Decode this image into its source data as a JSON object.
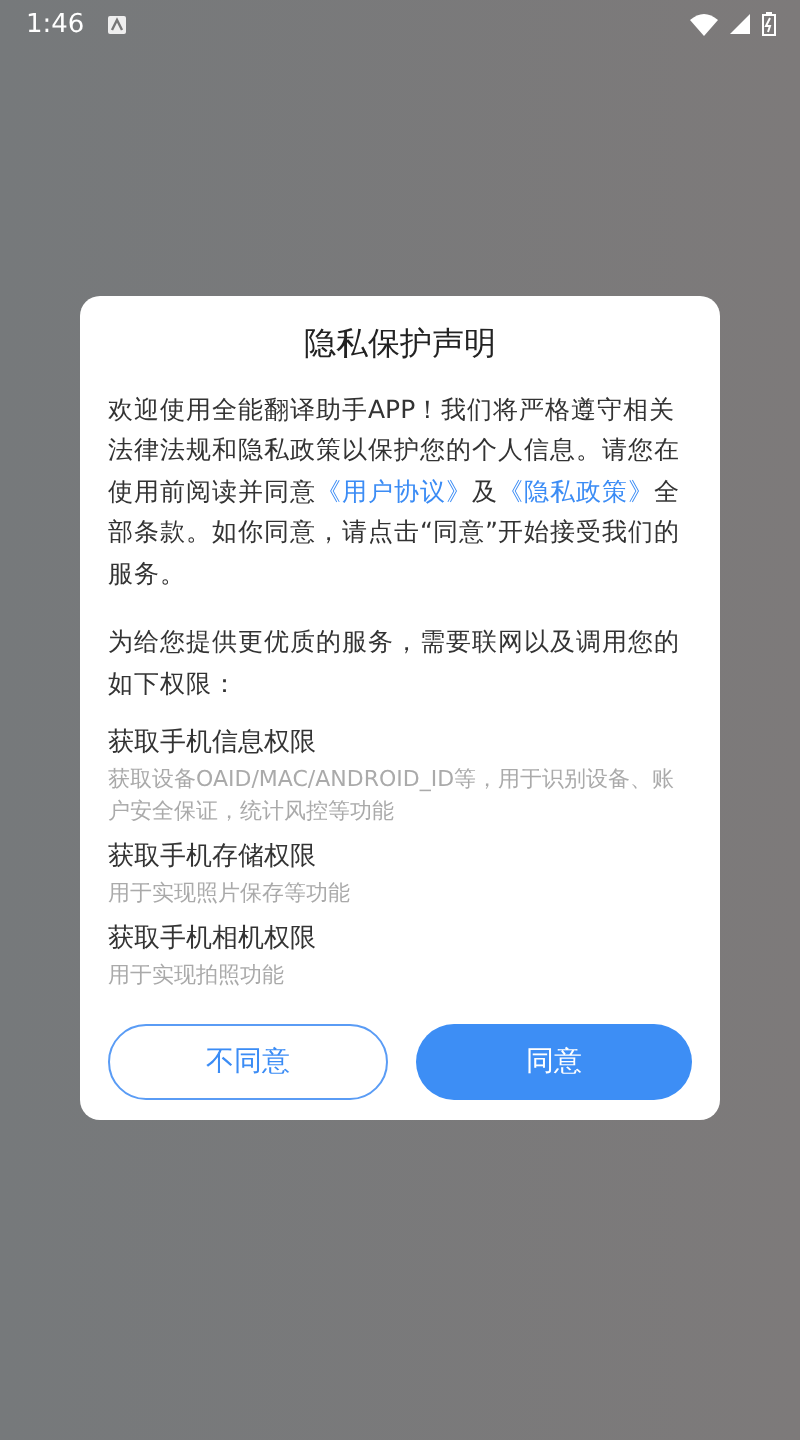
{
  "status_bar": {
    "time": "1:46"
  },
  "dialog": {
    "title": "隐私保护声明",
    "intro": [
      {
        "kind": "text",
        "text": "欢迎使用全能翻译助手APP！我们将严格遵守相关法律法规和隐私政策以保护您的个人信息。请您在使用前阅读并同意"
      },
      {
        "kind": "link",
        "text": "《用户协议》"
      },
      {
        "kind": "text",
        "text": "及"
      },
      {
        "kind": "link",
        "text": "《隐私政策》"
      },
      {
        "kind": "text",
        "text": "全部条款。如你同意，请点击“同意”开始接受我们的服务。"
      }
    ],
    "notice": "为给您提供更优质的服务，需要联网以及调用您的如下权限：",
    "permissions": [
      {
        "title": "获取手机信息权限",
        "description": "获取设备OAID/MAC/ANDROID_ID等，用于识别设备、账户安全保证，统计风控等功能"
      },
      {
        "title": "获取手机存储权限",
        "description": "用于实现照片保存等功能"
      },
      {
        "title": "获取手机相机权限",
        "description": "用于实现拍照功能"
      }
    ],
    "buttons": [
      {
        "kind": "secondary",
        "label": "不同意"
      },
      {
        "kind": "primary",
        "label": "同意"
      }
    ]
  }
}
